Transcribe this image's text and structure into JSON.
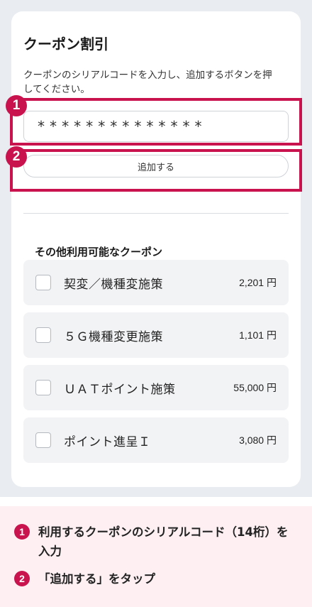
{
  "coupon_panel": {
    "title": "クーポン割引",
    "description": "クーポンのシリアルコードを入力し、追加するボタンを押してください。",
    "serial_input_value": "**************",
    "add_button_label": "追加する",
    "other_coupons_title": "その他利用可能なクーポン",
    "coupons": [
      {
        "name": "契変／機種変施策",
        "price": "2,201 円",
        "checked": false
      },
      {
        "name": "５Ｇ機種変更施策",
        "price": "1,101 円",
        "checked": false
      },
      {
        "name": "ＵＡＴポイント施策",
        "price": "55,000 円",
        "checked": false
      },
      {
        "name": "ポイント進呈Ｉ",
        "price": "3,080 円",
        "checked": false
      }
    ]
  },
  "callouts": {
    "badge_1": "1",
    "badge_2": "2"
  },
  "instructions": [
    {
      "number": "1",
      "text": "利用するクーポンのシリアルコード（14桁）を入力"
    },
    {
      "number": "2",
      "text": "「追加する」をタップ"
    }
  ],
  "colors": {
    "accent": "#c8134e",
    "screen_bg": "#e9ecf0",
    "legend_bg": "#fdeff2"
  }
}
